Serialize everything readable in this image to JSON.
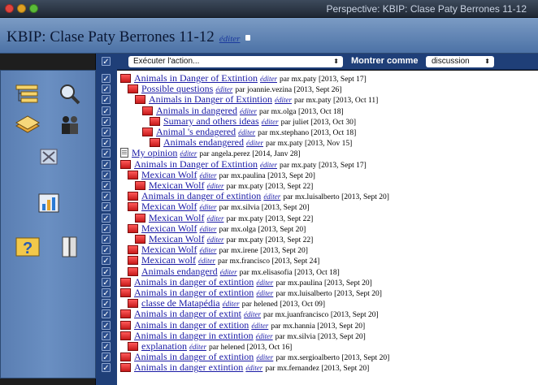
{
  "window": {
    "title": "Perspective: KBIP: Clase Paty Berrones 11-12"
  },
  "header": {
    "title": "KBIP: Clase Paty Berrones 11-12",
    "edit_label": "éditer"
  },
  "sidebar": {
    "icons": [
      "hierarchy-icon",
      "magnifier-icon",
      "stack-icon",
      "people-icon",
      "close-box-icon",
      "chart-icon",
      "help-icon",
      "book-icon"
    ]
  },
  "toolbar": {
    "action_select": "Exécuter l'action...",
    "show_as_label": "Montrer comme",
    "view_select": "discussion"
  },
  "entries": [
    {
      "title": "Animals in Danger of Extintion",
      "user": "mx.paty",
      "date": "[2013, Sept 17]",
      "indent": 0,
      "icon": "book"
    },
    {
      "title": "Possible questions",
      "user": "joannie.vezina",
      "date": "[2013, Sept 26]",
      "indent": 1,
      "icon": "book"
    },
    {
      "title": "Animals in Danger of Extintion",
      "user": "mx.paty",
      "date": "[2013, Oct 11]",
      "indent": 2,
      "icon": "book"
    },
    {
      "title": "Animals in dangered",
      "user": "mx.olga",
      "date": "[2013, Oct 18]",
      "indent": 3,
      "icon": "book"
    },
    {
      "title": "Sumary and others ideas",
      "user": "juliet",
      "date": "[2013, Oct 30]",
      "indent": 4,
      "icon": "book"
    },
    {
      "title": "Animal 's endagered",
      "user": "mx.stephano",
      "date": "[2013, Oct 18]",
      "indent": 3,
      "icon": "book"
    },
    {
      "title": "Animals endangered",
      "user": "mx.paty",
      "date": "[2013, Nov 15]",
      "indent": 4,
      "icon": "book"
    },
    {
      "title": "My opinion",
      "user": "angela.perez",
      "date": "[2014, Janv 28]",
      "indent": 0,
      "icon": "page"
    },
    {
      "title": "Animals in Danger of Extintion",
      "user": "mx.paty",
      "date": "[2013, Sept 17]",
      "indent": 0,
      "icon": "book"
    },
    {
      "title": "Mexican Wolf",
      "user": "mx.paulina",
      "date": "[2013, Sept 20]",
      "indent": 1,
      "icon": "book"
    },
    {
      "title": "Mexican Wolf",
      "user": "mx.paty",
      "date": "[2013, Sept 22]",
      "indent": 2,
      "icon": "book"
    },
    {
      "title": "Animals in danger of extintion",
      "user": "mx.luisalberto",
      "date": "[2013, Sept 20]",
      "indent": 1,
      "icon": "book"
    },
    {
      "title": "Mexican Wolf",
      "user": "mx.silvia",
      "date": "[2013, Sept 20]",
      "indent": 1,
      "icon": "book"
    },
    {
      "title": "Mexican Wolf",
      "user": "mx.paty",
      "date": "[2013, Sept 22]",
      "indent": 2,
      "icon": "book"
    },
    {
      "title": "Mexican Wolf",
      "user": "mx.olga",
      "date": "[2013, Sept 20]",
      "indent": 1,
      "icon": "book"
    },
    {
      "title": "Mexican Wolf",
      "user": "mx.paty",
      "date": "[2013, Sept 22]",
      "indent": 2,
      "icon": "book"
    },
    {
      "title": "Mexican Wolf",
      "user": "mx.irene",
      "date": "[2013, Sept 20]",
      "indent": 1,
      "icon": "book"
    },
    {
      "title": "Mexican wolf",
      "user": "mx.francisco",
      "date": "[2013, Sept 24]",
      "indent": 1,
      "icon": "book"
    },
    {
      "title": "Animals endangerd",
      "user": "mx.elisasofia",
      "date": "[2013, Oct 18]",
      "indent": 1,
      "icon": "book"
    },
    {
      "title": "Animals in danger of extintion",
      "user": "mx.paulina",
      "date": "[2013, Sept 20]",
      "indent": 0,
      "icon": "book"
    },
    {
      "title": "Animals in danger of extintion",
      "user": "mx.luisalberto",
      "date": "[2013, Sept 20]",
      "indent": 0,
      "icon": "book"
    },
    {
      "title": "classe de Matapédia",
      "user": "helened",
      "date": "[2013, Oct 09]",
      "indent": 1,
      "icon": "book"
    },
    {
      "title": "Animals in danger of extint",
      "user": "mx.juanfrancisco",
      "date": "[2013, Sept 20]",
      "indent": 0,
      "icon": "book"
    },
    {
      "title": "Animals in danger of extition",
      "user": "mx.hannia",
      "date": "[2013, Sept 20]",
      "indent": 0,
      "icon": "book"
    },
    {
      "title": "Animals in danger in extintion",
      "user": "mx.silvia",
      "date": "[2013, Sept 20]",
      "indent": 0,
      "icon": "book"
    },
    {
      "title": "explanation",
      "user": "helened",
      "date": "[2013, Oct 16]",
      "indent": 1,
      "icon": "book"
    },
    {
      "title": "Animals in danger of extintion",
      "user": "mx.sergioalberto",
      "date": "[2013, Sept 20]",
      "indent": 0,
      "icon": "book"
    },
    {
      "title": "Animals in danger extintion",
      "user": "mx.fernandez",
      "date": "[2013, Sept 20]",
      "indent": 0,
      "icon": "book"
    }
  ],
  "labels": {
    "edit": "éditer",
    "by": "par"
  }
}
